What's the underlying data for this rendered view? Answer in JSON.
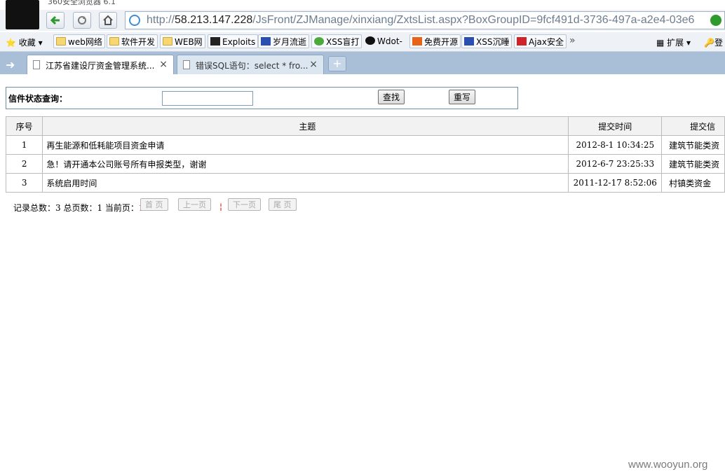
{
  "browser": {
    "app_title": "360安全浏览器 6.1",
    "url_scheme": "http://",
    "url_host": "58.213.147.228",
    "url_path": "/JsFront/ZJManage/xinxiang/ZxtsList.aspx?BoxGroupID=9fcf491d-3736-497a-a2e4-03e6",
    "bookmarks": {
      "favorites": "收藏",
      "items": [
        "web网络",
        "软件开发",
        "WEB网",
        "Exploits",
        "岁月流逝",
        "XSS盲打",
        "Wdot-",
        "免费开源",
        "XSS沉睡",
        "Ajax安全"
      ],
      "more": "»",
      "extend": "扩展",
      "login": "登"
    },
    "tabs": [
      {
        "label": "江苏省建设厅资金管理系统...",
        "close": "×"
      },
      {
        "label": "错误SQL语句：select * fro...",
        "close": "×"
      }
    ],
    "new_tab": "+"
  },
  "query": {
    "label": "信件状态查询：",
    "input_value": "",
    "search_label": "查找",
    "reset_label": "重写"
  },
  "table": {
    "headers": [
      "序号",
      "主题",
      "提交时间",
      "提交信"
    ],
    "rows": [
      [
        "1",
        "再生能源和低耗能项目资金申请",
        "2012-8-1 10:34:25",
        "建筑节能类资"
      ],
      [
        "2",
        "急！请开通本公司账号所有申报类型，谢谢",
        "2012-6-7 23:25:33",
        "建筑节能类资"
      ],
      [
        "3",
        "系统启用时间",
        "2011-12-17 8:52:06",
        "村镇类资金"
      ]
    ]
  },
  "pager": {
    "summary": "记录总数：3 总页数：1 当前页：",
    "current_page": "1",
    "separator": "¦",
    "first": "首 页",
    "prev": "上一页",
    "next": "下一页",
    "last": "尾 页"
  },
  "watermark": "www.wooyun.org"
}
